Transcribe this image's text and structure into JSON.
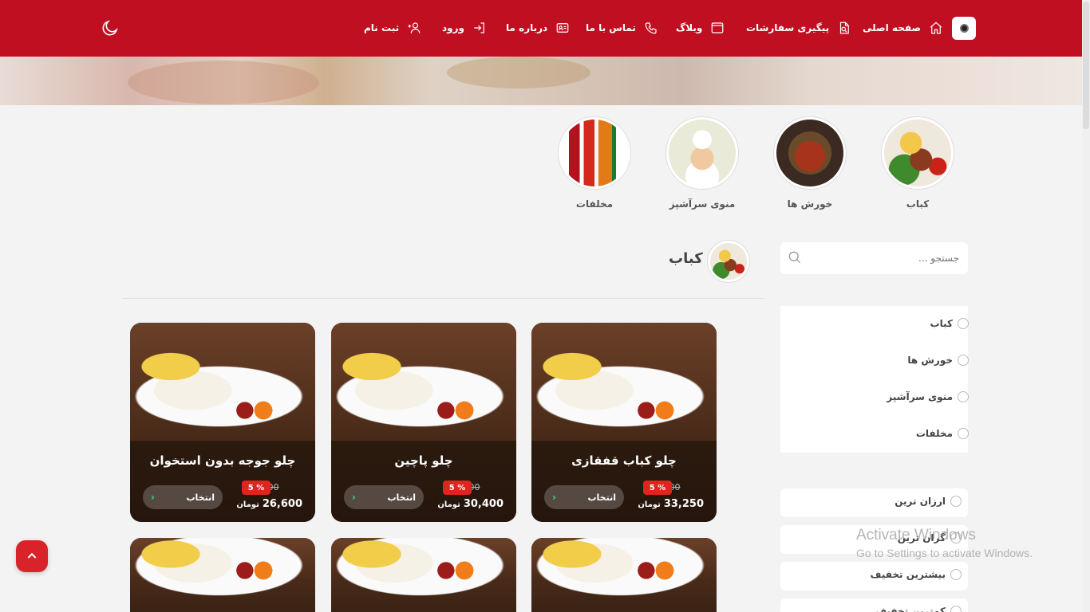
{
  "nav": {
    "home": "صفحه اصلی",
    "track_orders": "پیگیری سفارشات",
    "blog": "وبلاگ",
    "contact": "تماس با ما",
    "about": "درباره ما",
    "login": "ورود",
    "register": "ثبت نام"
  },
  "categories": [
    {
      "label": "کباب"
    },
    {
      "label": "خورش ها"
    },
    {
      "label": "منوی سرآشپز"
    },
    {
      "label": "مخلفات"
    }
  ],
  "section_title": "کباب",
  "search": {
    "placeholder": "جستجو ..."
  },
  "filters": [
    "کباب",
    "خورش ها",
    "منوی سرآشپز",
    "مخلفات"
  ],
  "sort_options": [
    "ارزان ترین",
    "گران ترین",
    "بیشترین تخفیف",
    "کمترین تخفیف"
  ],
  "products": [
    {
      "name": "چلو کباب قفقازی",
      "old_price": "35,000",
      "discount": "5 %",
      "price": "33,250",
      "currency": "تومان",
      "button": "انتخاب"
    },
    {
      "name": "چلو پاچین",
      "old_price": "32,000",
      "discount": "5 %",
      "price": "30,400",
      "currency": "تومان",
      "button": "انتخاب"
    },
    {
      "name": "چلو جوجه بدون استخوان",
      "old_price": "28,000",
      "discount": "5 %",
      "price": "26,600",
      "currency": "تومان",
      "button": "انتخاب"
    }
  ],
  "activation": {
    "line1": "Activate Windows",
    "line2": "Go to Settings to activate Windows."
  },
  "colors": {
    "brand": "#c10f22",
    "discount": "#e0241e",
    "accent_green": "#3fd88b"
  }
}
